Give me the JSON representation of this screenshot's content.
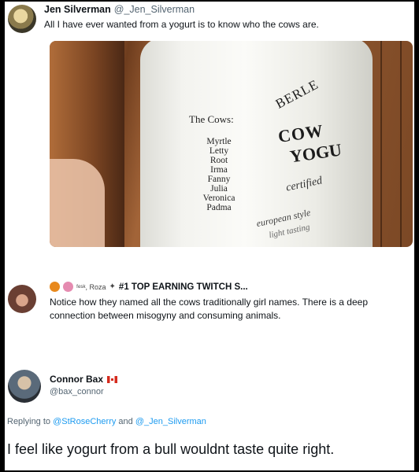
{
  "tweet1": {
    "author_name": "Jen Silverman",
    "author_handle": "@_Jen_Silverman",
    "text": "All I have ever wanted from a yogurt is to know who the cows are.",
    "photo": {
      "cows_title": "The Cows:",
      "cow_names": [
        "Myrtle",
        "Letty",
        "Root",
        "Irma",
        "Fanny",
        "Julia",
        "Veronica",
        "Padma"
      ],
      "brand": "BERLE",
      "product_line1": "COW",
      "product_line2": "YOGU",
      "certified": "certified",
      "european": "european style",
      "light": "light tasting"
    }
  },
  "tweet2": {
    "author_name": "ᶠᵉˢᵏ, Roza",
    "title": "#1 TOP EARNING TWITCH S...",
    "text": "Notice how they named all the cows traditionally girl names. There is a deep connection between misogyny and consuming animals."
  },
  "tweet3": {
    "author_name": "Connor Bax",
    "author_handle": "@bax_connor",
    "replying_prefix": "Replying to",
    "replying_to_1": "@StRoseCherry",
    "replying_and": "and",
    "replying_to_2": "@_Jen_Silverman",
    "text": "I feel like yogurt from a bull wouldnt taste quite right."
  },
  "colors": {
    "link": "#1d9bf0",
    "secondary_text": "#536471"
  }
}
